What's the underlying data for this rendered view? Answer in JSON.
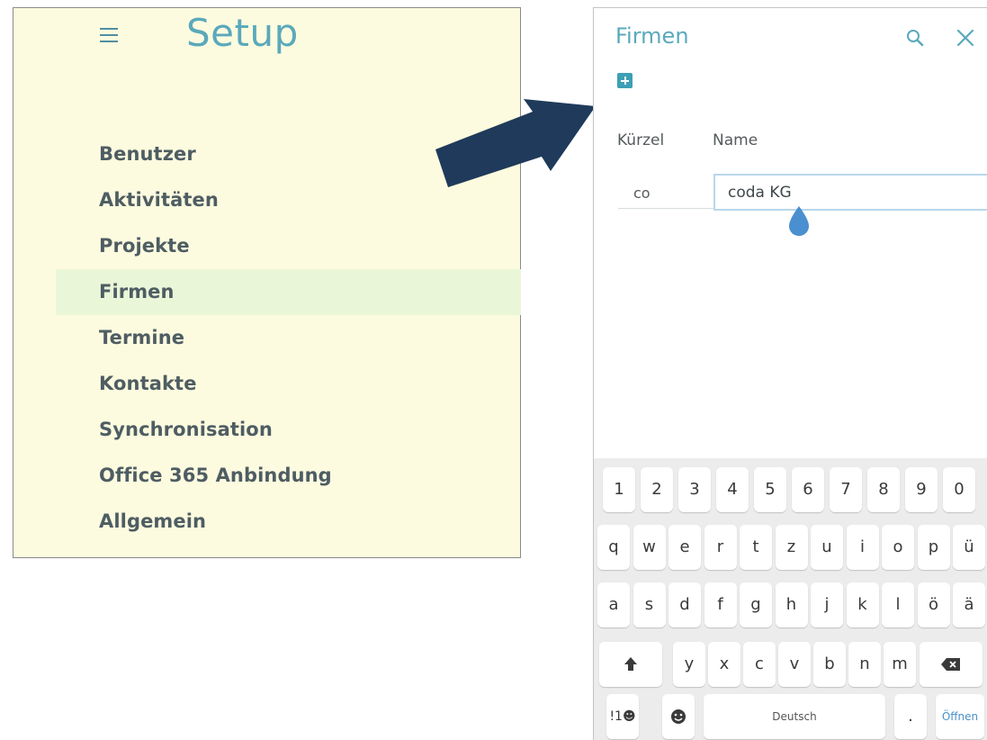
{
  "setup": {
    "title": "Setup",
    "menu": [
      {
        "label": "Benutzer"
      },
      {
        "label": "Aktivitäten"
      },
      {
        "label": "Projekte"
      },
      {
        "label": "Firmen",
        "active": true
      },
      {
        "label": "Termine"
      },
      {
        "label": "Kontakte"
      },
      {
        "label": "Synchronisation"
      },
      {
        "label": "Office 365 Anbindung"
      },
      {
        "label": "Allgemein"
      }
    ]
  },
  "firmen": {
    "title": "Firmen",
    "columns": {
      "kuerzel": "Kürzel",
      "name": "Name"
    },
    "row": {
      "kuerzel": "co",
      "name": "coda KG"
    }
  },
  "keyboard": {
    "row_numbers": [
      "1",
      "2",
      "3",
      "4",
      "5",
      "6",
      "7",
      "8",
      "9",
      "0"
    ],
    "row_top": [
      "q",
      "w",
      "e",
      "r",
      "t",
      "z",
      "u",
      "i",
      "o",
      "p",
      "ü"
    ],
    "row_mid": [
      "a",
      "s",
      "d",
      "f",
      "g",
      "h",
      "j",
      "k",
      "l",
      "ö",
      "ä"
    ],
    "row_low": [
      "y",
      "x",
      "c",
      "v",
      "b",
      "n",
      "m"
    ],
    "symbols_label": "!1☻",
    "space_label": "Deutsch",
    "period_label": ".",
    "action_label": "Öffnen"
  },
  "colors": {
    "accent": "#5aa9bb",
    "panel_bg": "#fdfbdf",
    "active_item_bg": "#eaf6d8",
    "arrow": "#1f3a5a",
    "add_button": "#3e9fb5"
  },
  "icons": [
    "menu-icon",
    "search-icon",
    "close-icon",
    "add-icon",
    "shift-icon",
    "backspace-icon",
    "emoji-icon"
  ]
}
